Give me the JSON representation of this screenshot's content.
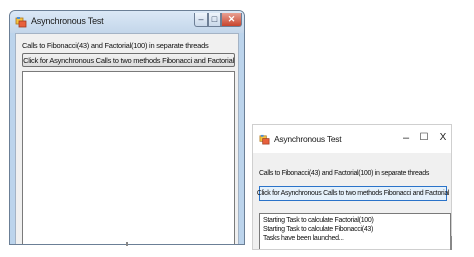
{
  "windows": [
    {
      "title": "Asynchronous Test",
      "controls": {
        "minimize": "‒",
        "maximize": "□",
        "close": "✕"
      },
      "label": "Calls to Fibonacci(43) and Factorial(100) in separate threads",
      "button_label": "Click for Asynchronous Calls to two methods Fibonacci and Factorial",
      "log": []
    },
    {
      "title": "Asynchronous Test",
      "controls": {
        "minimize": "–",
        "maximize": "☐",
        "close": "X"
      },
      "label": "Calls to Fibonacci(43) and Factorial(100) in separate threads",
      "button_label": "Click for Asynchronous Calls to two methods Fibonacci and Factorial",
      "log": [
        "Starting Task to calculate Factorial(100)",
        "Starting Task to calculate Fibonacci(43)",
        "Tasks have been launched..."
      ]
    }
  ],
  "colors": {
    "title_bar_win7": "#c3d6ea",
    "close_button_win7": "#c8442d",
    "button_focus_win10": "#2a73c9"
  }
}
